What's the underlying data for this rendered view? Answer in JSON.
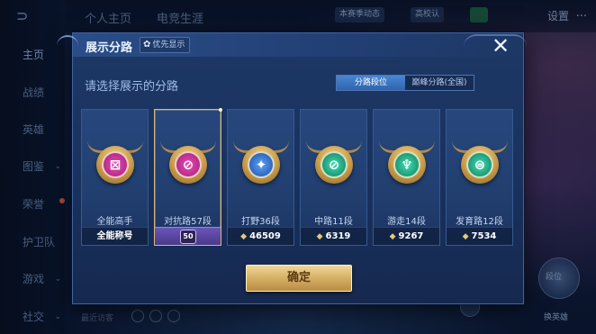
{
  "sidebar": {
    "logo_icon": "honor-logo-icon",
    "items": [
      {
        "label": "主页",
        "active": true
      },
      {
        "label": "战绩"
      },
      {
        "label": "英雄"
      },
      {
        "label": "图鉴"
      },
      {
        "label": "荣誉"
      },
      {
        "label": "护卫队"
      },
      {
        "label": "游戏"
      },
      {
        "label": "社交"
      }
    ]
  },
  "topbar": {
    "tabs": [
      "个人主页",
      "电竞生涯"
    ],
    "pill1": "本赛季动态",
    "pill2": "高校认",
    "pill3": "",
    "settings": "设置",
    "more": "..."
  },
  "bottombar": {
    "recent": "最近访客"
  },
  "dialog": {
    "title": "展示分路",
    "priority_label": "优先显示",
    "subtitle": "请选择展示的分路",
    "segments": [
      "分路段位",
      "巅峰分路(全国)"
    ],
    "active_segment": 0,
    "confirm_label": "确定",
    "cards": [
      {
        "label": "全能高手",
        "footer": "全能称号",
        "color": "#c02f94",
        "glyph": "⊠",
        "type": "title"
      },
      {
        "label": "对抗路57段",
        "footer": "50",
        "color": "#c02f94",
        "glyph": "⊘",
        "type": "level",
        "selected": true
      },
      {
        "label": "打野36段",
        "footer": "46509",
        "color": "#2d6fc2",
        "glyph": "✦",
        "type": "coins"
      },
      {
        "label": "中路11段",
        "footer": "6319",
        "color": "#1d9a7a",
        "glyph": "⊘",
        "type": "coins"
      },
      {
        "label": "游走14段",
        "footer": "9267",
        "color": "#1d9a7a",
        "glyph": "♆",
        "type": "coins"
      },
      {
        "label": "发育路12段",
        "footer": "7534",
        "color": "#1d9a7a",
        "glyph": "⊜",
        "type": "coins"
      }
    ]
  },
  "right": {
    "hero_label": "换英雄",
    "hero_sub": "段位"
  },
  "colors": {
    "accent_gold": "#d8b36a",
    "selected_border": "#d9b87a",
    "segment_active": "#3a74c4"
  }
}
